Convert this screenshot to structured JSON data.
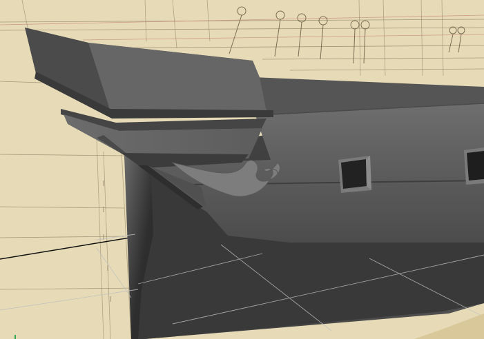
{
  "viewport": {
    "paper_color": "#eadfbd",
    "paper_shadow": "#dccfa6",
    "sketch_color": "#8a7c62",
    "red_guide_color": "#c98a7a",
    "hull_dark": "#3c3c3c",
    "hull_mid": "#5a5a5a",
    "hull_light": "#777777",
    "grid_color": "#bfbfbf",
    "axis_green": "#2fa84f"
  },
  "icons": {
    "axis_indicator": "axis-indicator-icon"
  }
}
